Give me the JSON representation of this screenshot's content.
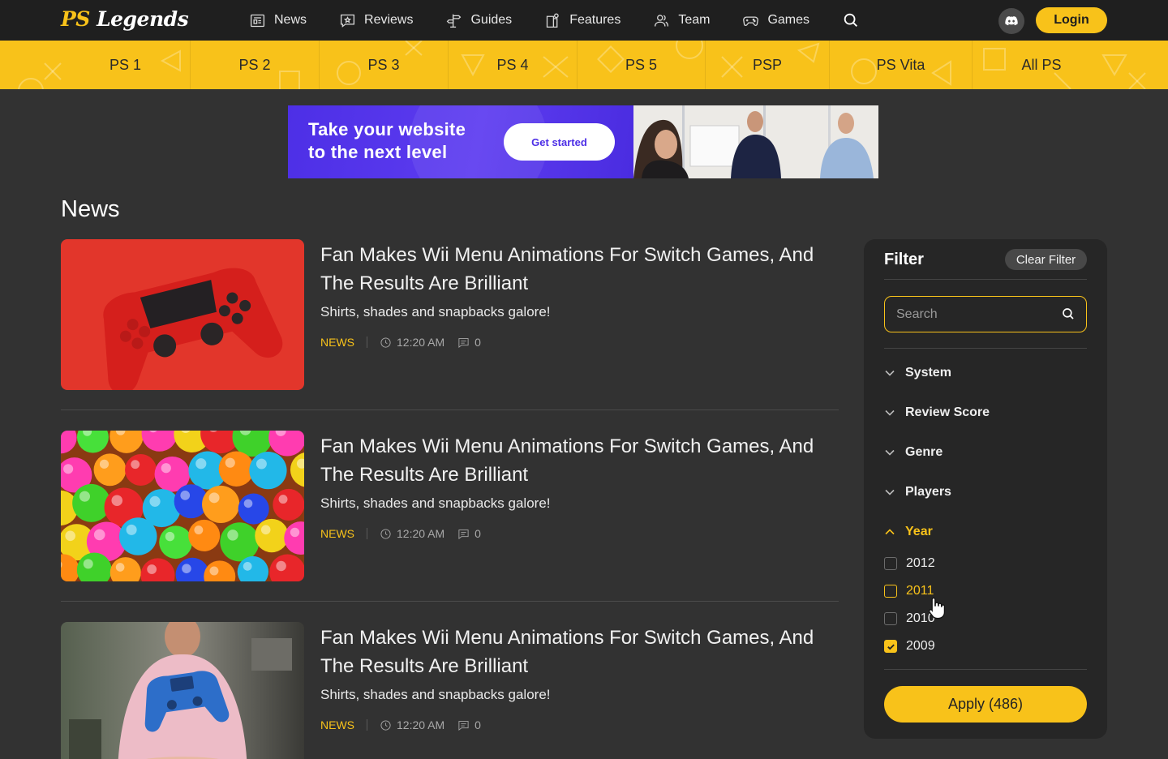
{
  "header": {
    "logo_ps": "PS",
    "logo_text": "Legends",
    "nav": [
      {
        "label": "News",
        "icon": "newspaper-icon"
      },
      {
        "label": "Reviews",
        "icon": "star-review-icon"
      },
      {
        "label": "Guides",
        "icon": "signpost-icon"
      },
      {
        "label": "Features",
        "icon": "feature-doc-icon"
      },
      {
        "label": "Team",
        "icon": "team-icon"
      },
      {
        "label": "Games",
        "icon": "gamepad-icon"
      }
    ],
    "login_label": "Login"
  },
  "platforms": [
    "PS 1",
    "PS 2",
    "PS 3",
    "PS 4",
    "PS 5",
    "PSP",
    "PS Vita",
    "All PS"
  ],
  "banner": {
    "line1": "Take your website",
    "line2": "to the next level",
    "cta": "Get started"
  },
  "section_title": "News",
  "articles": [
    {
      "title": "Fan Makes Wii Menu Animations For Switch Games, And The Results Are Brilliant",
      "subtitle": "Shirts, shades and snapbacks galore!",
      "tag": "NEWS",
      "time": "12:20 AM",
      "comments": "0",
      "image": "red-controller"
    },
    {
      "title": "Fan Makes Wii Menu Animations For Switch Games, And The Results Are Brilliant",
      "subtitle": "Shirts, shades and snapbacks galore!",
      "tag": "NEWS",
      "time": "12:20 AM",
      "comments": "0",
      "image": "colorful-balls"
    },
    {
      "title": "Fan Makes Wii Menu Animations For Switch Games, And The Results Are Brilliant",
      "subtitle": "Shirts, shades and snapbacks galore!",
      "tag": "NEWS",
      "time": "12:20 AM",
      "comments": "0",
      "image": "person-blue-controller"
    }
  ],
  "filter": {
    "title": "Filter",
    "clear_label": "Clear Filter",
    "search_placeholder": "Search",
    "facets": [
      "System",
      "Review Score",
      "Genre",
      "Players"
    ],
    "open_facet": "Year",
    "years": [
      {
        "label": "2012",
        "checked": false,
        "hover": false
      },
      {
        "label": "2011",
        "checked": false,
        "hover": true
      },
      {
        "label": "2010",
        "checked": false,
        "hover": false
      },
      {
        "label": "2009",
        "checked": true,
        "hover": false
      }
    ],
    "apply_label": "Apply (486)"
  },
  "colors": {
    "accent": "#f8c21a",
    "background": "#323232",
    "topbar": "#1f1f1f",
    "panel": "#262626",
    "banner": "#4d2fe6"
  }
}
